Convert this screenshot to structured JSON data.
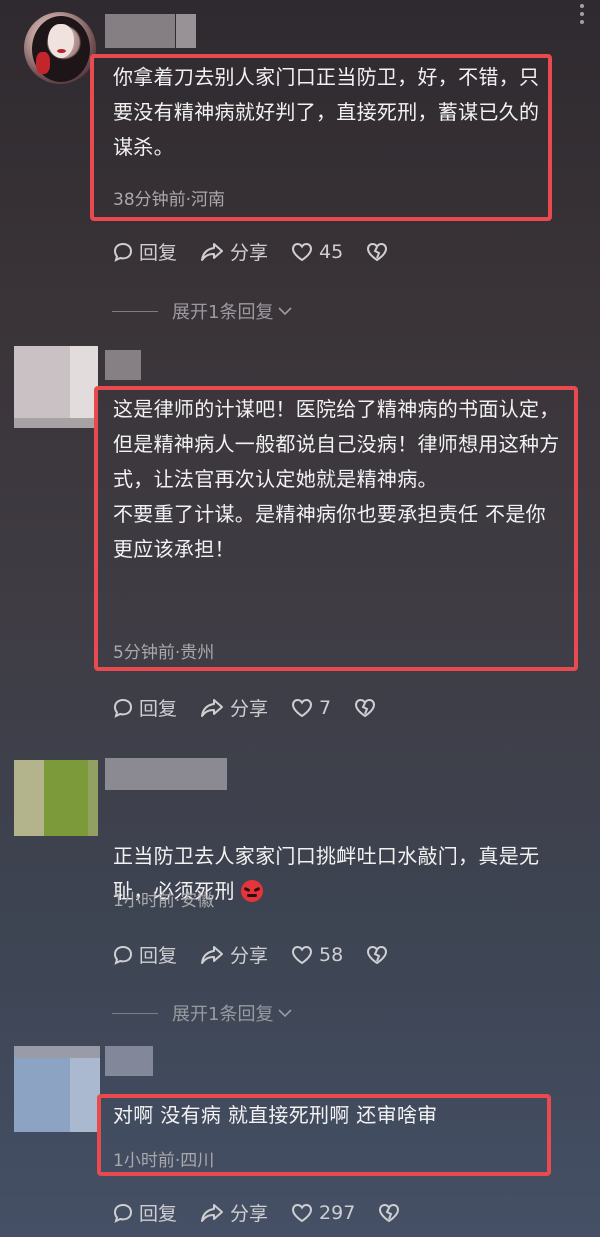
{
  "comments": [
    {
      "text": "你拿着刀去别人家门口正当防卫，好，不错，只要没有精神病就好判了，直接死刑，蓄谋已久的谋杀。",
      "meta": "38分钟前·河南",
      "reply_label": "回复",
      "share_label": "分享",
      "likes": "45",
      "expand_label": "展开1条回复"
    },
    {
      "text": "这是律师的计谋吧！医院给了精神病的书面认定，但是精神病人一般都说自己没病！律师想用这种方式，让法官再次认定她就是精神病。\n不要重了计谋。是精神病你也要承担责任 不是你更应该承担！",
      "meta": "5分钟前·贵州",
      "reply_label": "回复",
      "share_label": "分享",
      "likes": "7"
    },
    {
      "text": "正当防卫去人家家门口挑衅吐口水敲门，真是无耻，必须死刑",
      "meta": "1小时前·安徽",
      "reply_label": "回复",
      "share_label": "分享",
      "likes": "58",
      "expand_label": "展开1条回复"
    },
    {
      "text": "对啊 没有病 就直接死刑啊 还审啥审",
      "meta": "1小时前·四川",
      "reply_label": "回复",
      "share_label": "分享",
      "likes": "297"
    }
  ],
  "icons": {
    "reply": "comment-bubble-icon",
    "share": "share-arrow-icon",
    "like": "heart-icon",
    "dislike": "broken-heart-icon",
    "expand": "chevron-down-icon",
    "emoji": "angry-face-emoji"
  },
  "colors": {
    "highlight_border": "#e84a4f",
    "meta_text": "#a9a8ab"
  }
}
